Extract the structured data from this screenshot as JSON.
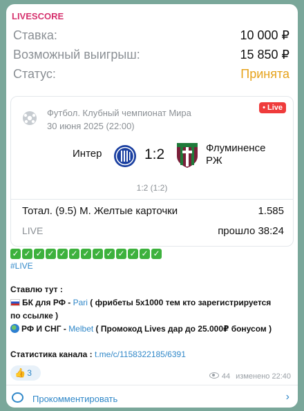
{
  "channel": "LIVESCORE",
  "bet": {
    "stake_label": "Ставка:",
    "stake_value": "10 000 ₽",
    "payout_label": "Возможный выигрыш:",
    "payout_value": "15 850 ₽",
    "status_label": "Статус:",
    "status_value": "Принята"
  },
  "match": {
    "competition": "Футбол. Клубный чемпионат Мира",
    "datetime": "30 июня 2025 (22:00)",
    "live_badge": "• Live",
    "team1": "Интер",
    "score": "1:2",
    "team2_line1": "Флуминенсе",
    "team2_line2": "РЖ",
    "halftime": "1:2 (1:2)",
    "market": "Тотал. (9.5) М. Желтые карточки",
    "coefficient": "1.585",
    "live_label": "LIVE",
    "elapsed": "прошло 38:24"
  },
  "checkmarks": [
    "✓",
    "✓",
    "✓",
    "✓",
    "✓",
    "✓",
    "✓",
    "✓",
    "✓",
    "✓",
    "✓",
    "✓",
    "✓"
  ],
  "hashtag": "#LIVE",
  "text": {
    "bet_here": "Ставлю тут :",
    "line1_prefix": "БК для РФ - ",
    "line1_link": "Pari",
    "line1_rest": " ( фрибеты 5х1000 тем кто зарегистрируется",
    "line1_cont": "по ссылке )",
    "line2_prefix": "РФ И СНГ - ",
    "line2_link": "Melbet",
    "line2_mid": " ( Промокод ",
    "line2_promo": "Lives",
    "line2_mid2": " дар до ",
    "line2_amount": "25.000₽",
    "line2_end": " бонусом )",
    "stats_label": "Статистика канала : ",
    "stats_link": "t.me/c/1158322185/6391"
  },
  "reaction": {
    "emoji": "👍",
    "count": "3"
  },
  "meta": {
    "views": "44",
    "edited": "изменено 22:40"
  },
  "comment": {
    "label": "Прокомментировать"
  },
  "colors": {
    "accent": "#2f87c8",
    "channel": "#d6326e",
    "status": "#e6a21a",
    "live": "#ef3b3b",
    "check": "#3db13d"
  }
}
